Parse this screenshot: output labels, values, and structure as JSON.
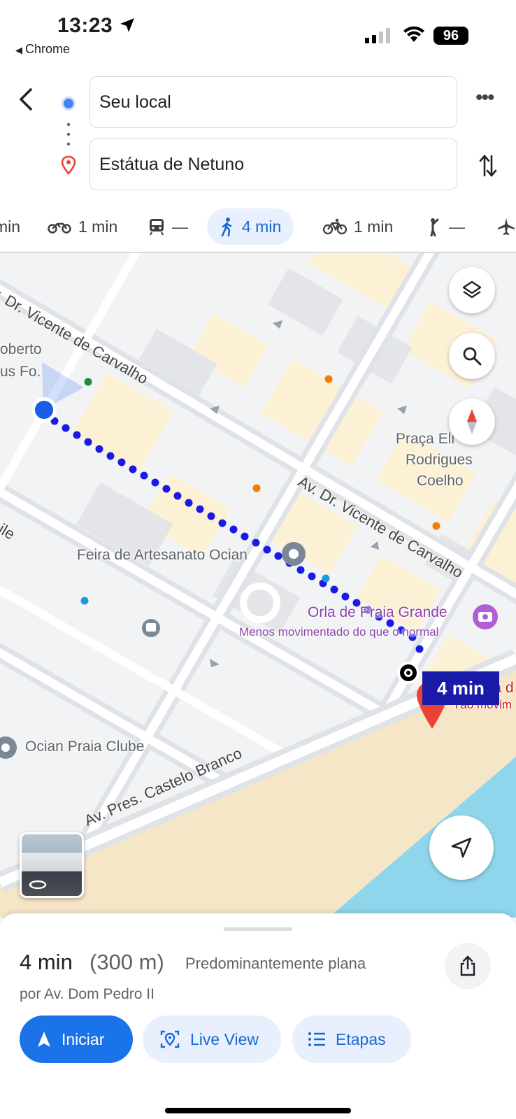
{
  "status_bar": {
    "time": "13:23",
    "back_app": "Chrome",
    "battery": "96",
    "icons": [
      "location-arrow-icon",
      "signal-icon",
      "wifi-icon",
      "battery-icon"
    ]
  },
  "route": {
    "origin": "Seu local",
    "destination": "Estátua de Netuno"
  },
  "modes": [
    {
      "icon": "car-icon",
      "label": "min",
      "active": false
    },
    {
      "icon": "motorcycle-icon",
      "label": "1 min",
      "active": false
    },
    {
      "icon": "transit-icon",
      "label": "—",
      "active": false
    },
    {
      "icon": "walk-icon",
      "label": "4 min",
      "active": true
    },
    {
      "icon": "bike-icon",
      "label": "1 min",
      "active": false
    },
    {
      "icon": "ride-hail-icon",
      "label": "—",
      "active": false
    },
    {
      "icon": "flight-icon",
      "label": "",
      "active": false
    }
  ],
  "map": {
    "streets": {
      "vicente_top": "v. Dr. Vicente de Carvalho",
      "vicente_mid": "Av. Dr. Vicente de Carvalho",
      "castelo": "Av. Pres. Castelo Branco",
      "left_partial": "ile"
    },
    "places": {
      "roberto_1": "oberto",
      "roberto_2": "us Fo.",
      "praca_1": "Praça Eli",
      "praca_2": "Rodrigues",
      "praca_3": "Coelho",
      "feira": "Feira de Artesanato Ocian",
      "orla": "Orla de Praia Grande",
      "orla_status": "Menos movimentado do que o normal",
      "netuno_partial": "Estátua d",
      "netuno_status": "Tão movim",
      "ocian": "Ocian Praia Clube"
    },
    "route_time": "4 min",
    "colors": {
      "route": "#1a1ae6",
      "land": "#f1f3f4",
      "buildings": "#fdf1d5",
      "beach": "#f5e6c8",
      "sea": "#8fd6ec"
    }
  },
  "sheet": {
    "eta": "4 min",
    "distance": "(300 m)",
    "terrain": "Predominantemente plana",
    "via": "por Av. Dom Pedro II",
    "buttons": {
      "start": "Iniciar",
      "live": "Live View",
      "steps": "Etapas"
    },
    "accent": "#1a73e8"
  }
}
